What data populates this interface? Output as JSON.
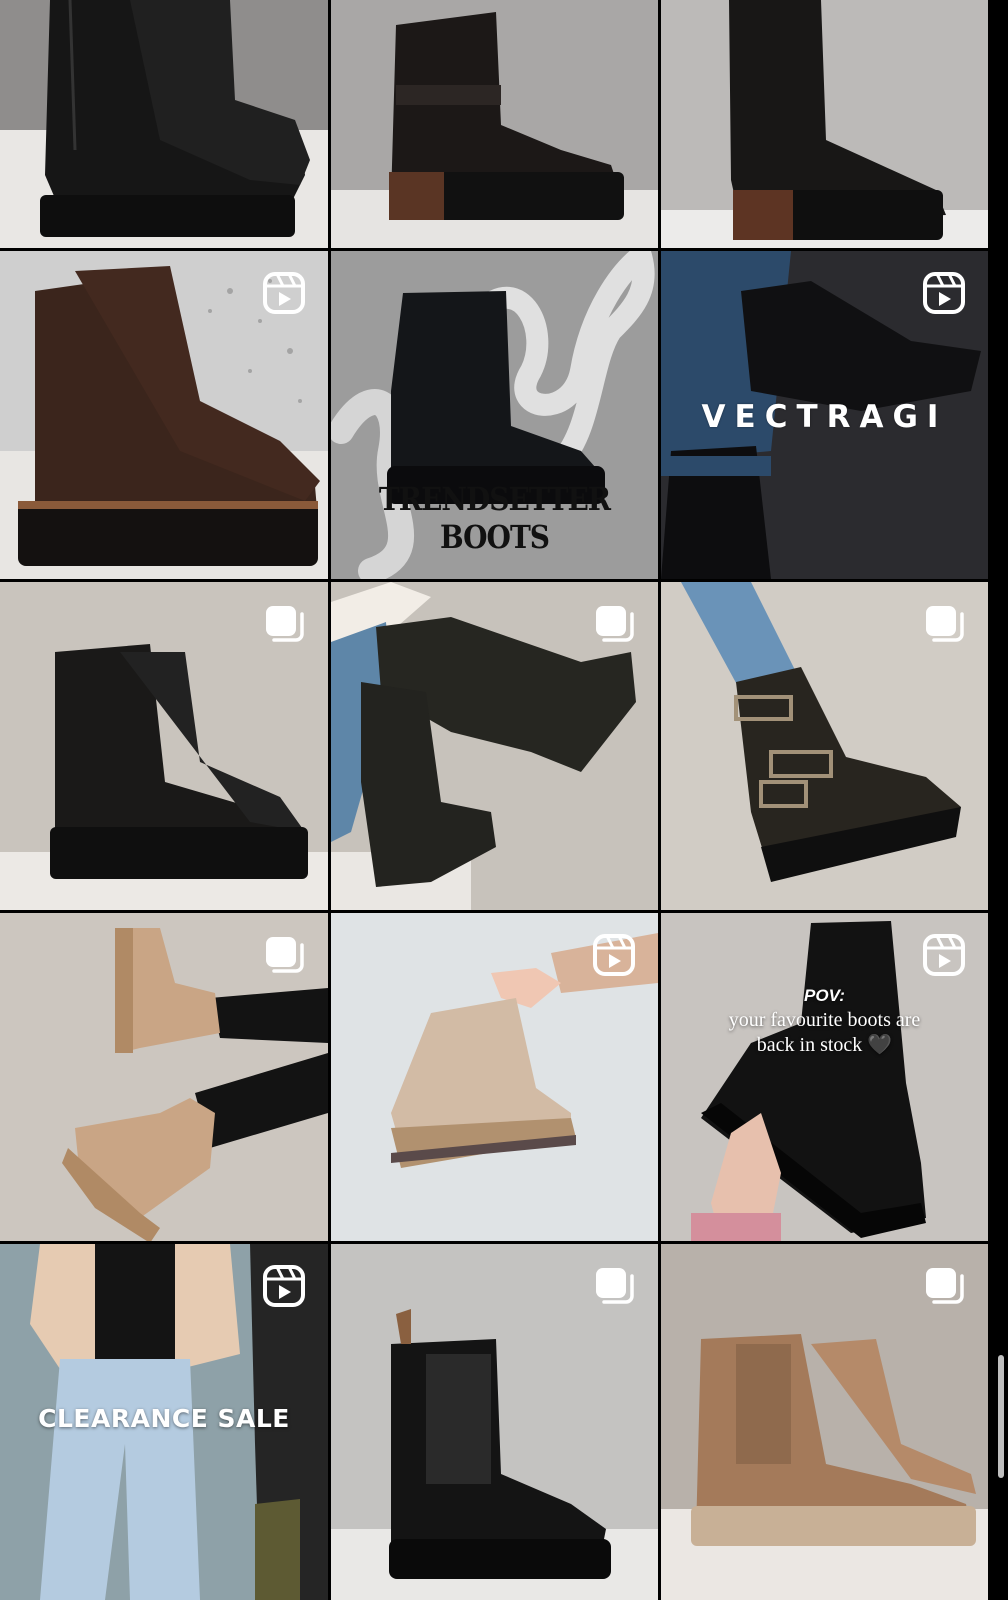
{
  "grid": {
    "tiles": [
      {
        "id": "r1c1",
        "badge": "none",
        "bg": "#8e8c8b",
        "boot_color": "#1a1a1a"
      },
      {
        "id": "r1c2",
        "badge": "none",
        "bg": "#a9a7a6",
        "boot_color": "#1b1716"
      },
      {
        "id": "r1c3",
        "badge": "none",
        "bg": "#bcbab8",
        "boot_color": "#181716"
      },
      {
        "id": "r2c1",
        "badge": "reel-icon",
        "bg": "#cfcfcf",
        "boot_color": "#3a241b"
      },
      {
        "id": "r2c2",
        "badge": "none",
        "bg": "#9c9c9c",
        "boot_color": "#15171b",
        "overlay": "TRENDSETTER BOOTS"
      },
      {
        "id": "r2c3",
        "badge": "reel-icon",
        "bg": "#2a2a2e",
        "boot_color": "#121214",
        "overlay": "VECTRAGI"
      },
      {
        "id": "r3c1",
        "badge": "carousel-icon",
        "bg": "#c9c4bd",
        "boot_color": "#1a1918"
      },
      {
        "id": "r3c2",
        "badge": "carousel-icon",
        "bg": "#c7c2bb",
        "boot_color": "#262621"
      },
      {
        "id": "r3c3",
        "badge": "carousel-icon",
        "bg": "#d1ccc5",
        "boot_color": "#282521"
      },
      {
        "id": "r4c1",
        "badge": "carousel-icon",
        "bg": "#ccc6bf",
        "boot_color": "#c9a585"
      },
      {
        "id": "r4c2",
        "badge": "reel-icon",
        "bg": "#dfe3e5",
        "boot_color": "#d2bba5"
      },
      {
        "id": "r4c3",
        "badge": "reel-icon",
        "bg": "#c8c4c0",
        "boot_color": "#121212",
        "overlay_head": "POV:",
        "overlay_lines": [
          "your favourite boots are",
          "back in stock 🖤"
        ]
      },
      {
        "id": "r5c1",
        "badge": "reel-icon",
        "bg": "#8ea1a8",
        "boot_color": "#e6cbb2",
        "overlay": "CLEARANCE SALE"
      },
      {
        "id": "r5c2",
        "badge": "carousel-icon",
        "bg": "#c4c3c1",
        "boot_color": "#141414"
      },
      {
        "id": "r5c3",
        "badge": "carousel-icon",
        "bg": "#b8b1aa",
        "boot_color": "#a47a5a"
      }
    ]
  },
  "colors": {
    "divider": "#000000",
    "overlay_text": "#ffffff",
    "badge": "#ffffff"
  }
}
